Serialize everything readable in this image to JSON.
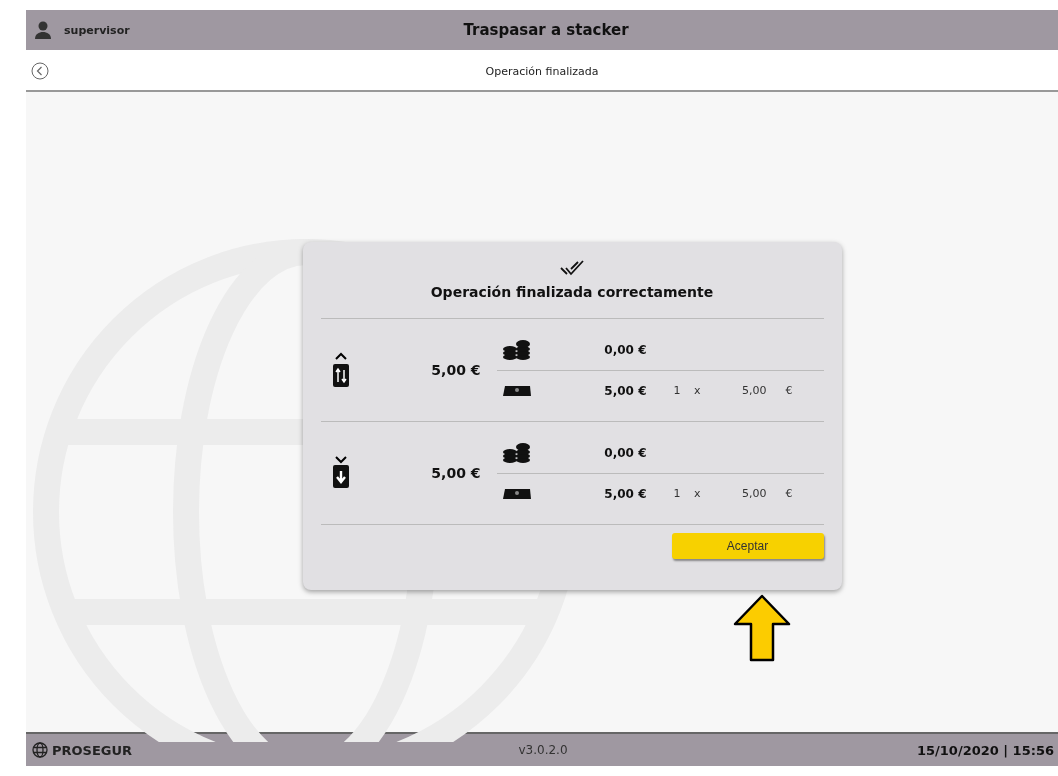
{
  "header": {
    "user": "supervisor",
    "title": "Traspasar a stacker"
  },
  "subheader": {
    "title": "Operación finalizada"
  },
  "dialog": {
    "title": "Operación finalizada correctamente",
    "sections": [
      {
        "kind": "upload",
        "total": "5,00 €",
        "coins": {
          "amount": "0,00 €"
        },
        "notes": {
          "amount": "5,00 €",
          "count": "1",
          "times": "x",
          "denomination": "5,00",
          "currency": "€"
        }
      },
      {
        "kind": "download",
        "total": "5,00 €",
        "coins": {
          "amount": "0,00 €"
        },
        "notes": {
          "amount": "5,00 €",
          "count": "1",
          "times": "x",
          "denomination": "5,00",
          "currency": "€"
        }
      }
    ],
    "button": "Aceptar"
  },
  "footer": {
    "brand": "PROSEGUR",
    "version": "v3.0.2.0",
    "datetime": "15/10/2020 | 15:56"
  }
}
